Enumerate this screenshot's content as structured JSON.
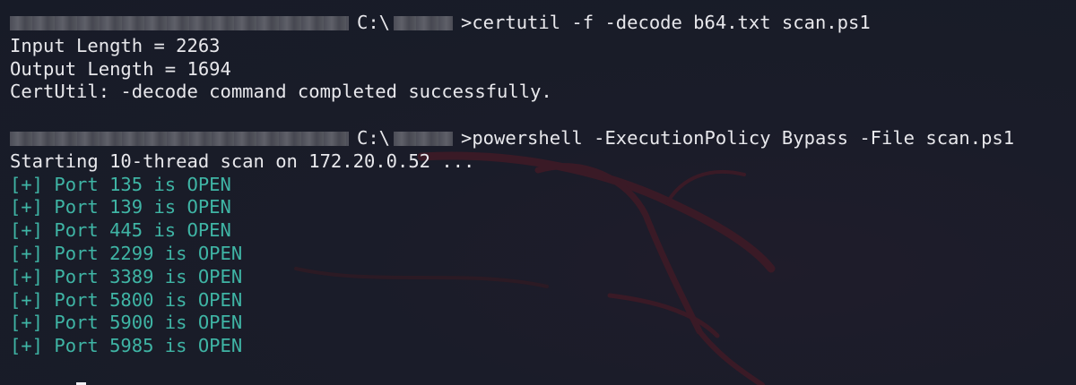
{
  "terminal": {
    "prompt1": {
      "drive": "C:\\",
      "command": ">certutil -f -decode b64.txt scan.ps1"
    },
    "output1": [
      "Input Length = 2263",
      "Output Length = 1694",
      "CertUtil: -decode command completed successfully."
    ],
    "prompt2": {
      "drive": "C:\\",
      "command": ">powershell -ExecutionPolicy Bypass -File scan.ps1"
    },
    "scan_start": "Starting 10-thread scan on 172.20.0.52 ...",
    "results": [
      "[+] Port 135 is OPEN",
      "[+] Port 139 is OPEN",
      "[+] Port 445 is OPEN",
      "[+] Port 2299 is OPEN",
      "[+] Port 3389 is OPEN",
      "[+] Port 5800 is OPEN",
      "[+] Port 5900 is OPEN",
      "[+] Port 5985 is OPEN"
    ],
    "colors": {
      "background": "#181c28",
      "text": "#e8e8ec",
      "open_status": "#3fb5a5",
      "watermark": "#3a1a24"
    }
  }
}
